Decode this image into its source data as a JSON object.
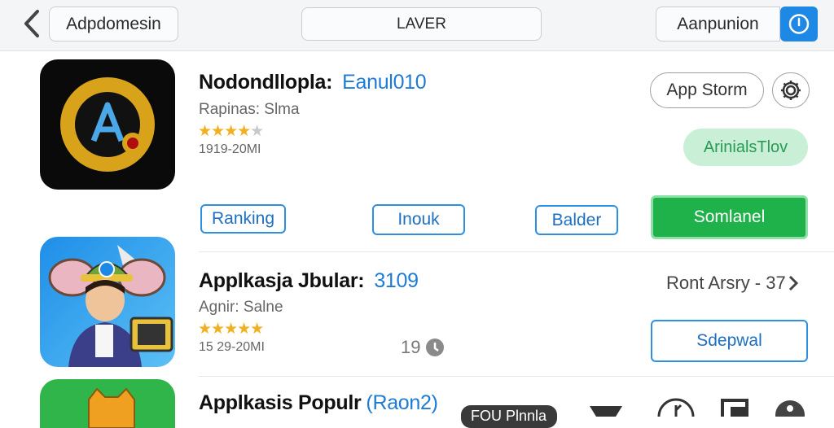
{
  "header": {
    "back_label": "Adpdomesin",
    "search_label": "LAVER",
    "account_label": "Aanpunion"
  },
  "app1": {
    "name": "Nodondllopla:",
    "tag": "Eanul010",
    "subtitle": "Rapinas: Slma",
    "rating": 4,
    "size": "1919-20MI",
    "store_button": "App Storm",
    "status_chip": "ArinialsTlov",
    "actions": [
      "Ranking",
      "Inouk",
      "Balder"
    ],
    "primary_action": "Somlanel"
  },
  "app2": {
    "name": "Applkasja Jbular:",
    "tag": "3109",
    "subtitle": "Agnir: Salne",
    "rating": 5,
    "size": "15 29-20MI",
    "count": "19",
    "link": "Ront Arsry - 37",
    "button": "Sdepwal"
  },
  "app3": {
    "name": "Applkasis Populr",
    "tag": "(Raon2)",
    "bottom_chip": "FOU Plnnla"
  },
  "colors": {
    "accent": "#1e88e5",
    "green": "#1fb24a",
    "star": "#f2b01e"
  }
}
